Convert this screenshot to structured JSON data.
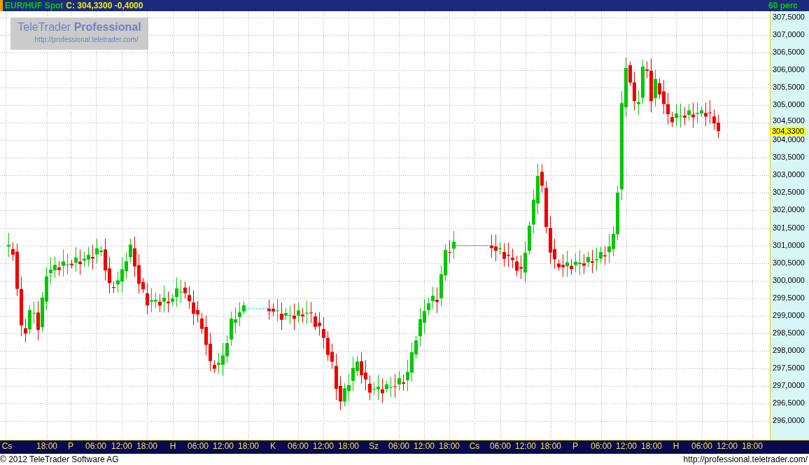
{
  "header": {
    "instrument": "EUR/HUF Spot",
    "quote": "C: 304,3300 -0,4000",
    "interval": "60 perc"
  },
  "logo": {
    "name": "TeleTrader **Professional**",
    "url": "http://professional.teletrader.com/"
  },
  "price_axis": {
    "labels": [
      "307,5000",
      "307,0000",
      "306,5000",
      "306,0000",
      "305,5000",
      "305,0000",
      "304,5000",
      "304,0000",
      "303,5000",
      "303,0000",
      "302,5000",
      "302,0000",
      "301,5000",
      "301,0000",
      "300,5000",
      "300,0000",
      "299,5000",
      "299,0000",
      "298,5000",
      "298,0000",
      "297,5000",
      "297,0000",
      "296,5000",
      "296,0000"
    ],
    "last_price": "304,3300"
  },
  "time_axis": {
    "labels": [
      "Cs",
      "18:00",
      "P",
      "06:00",
      "12:00",
      "18:00",
      "H",
      "06:00",
      "12:00",
      "18:00",
      "K",
      "06:00",
      "12:00",
      "18:00",
      "Sz",
      "06:00",
      "12:00",
      "18:00",
      "Cs",
      "06:00",
      "12:00",
      "18:00",
      "P",
      "06:00",
      "12:00",
      "18:00",
      "H",
      "06:00",
      "12:00",
      "18:00"
    ]
  },
  "footer": {
    "copyright": "© 2012 TeleTrader Software AG",
    "url": "http://professional.teletrader.com/"
  }
}
